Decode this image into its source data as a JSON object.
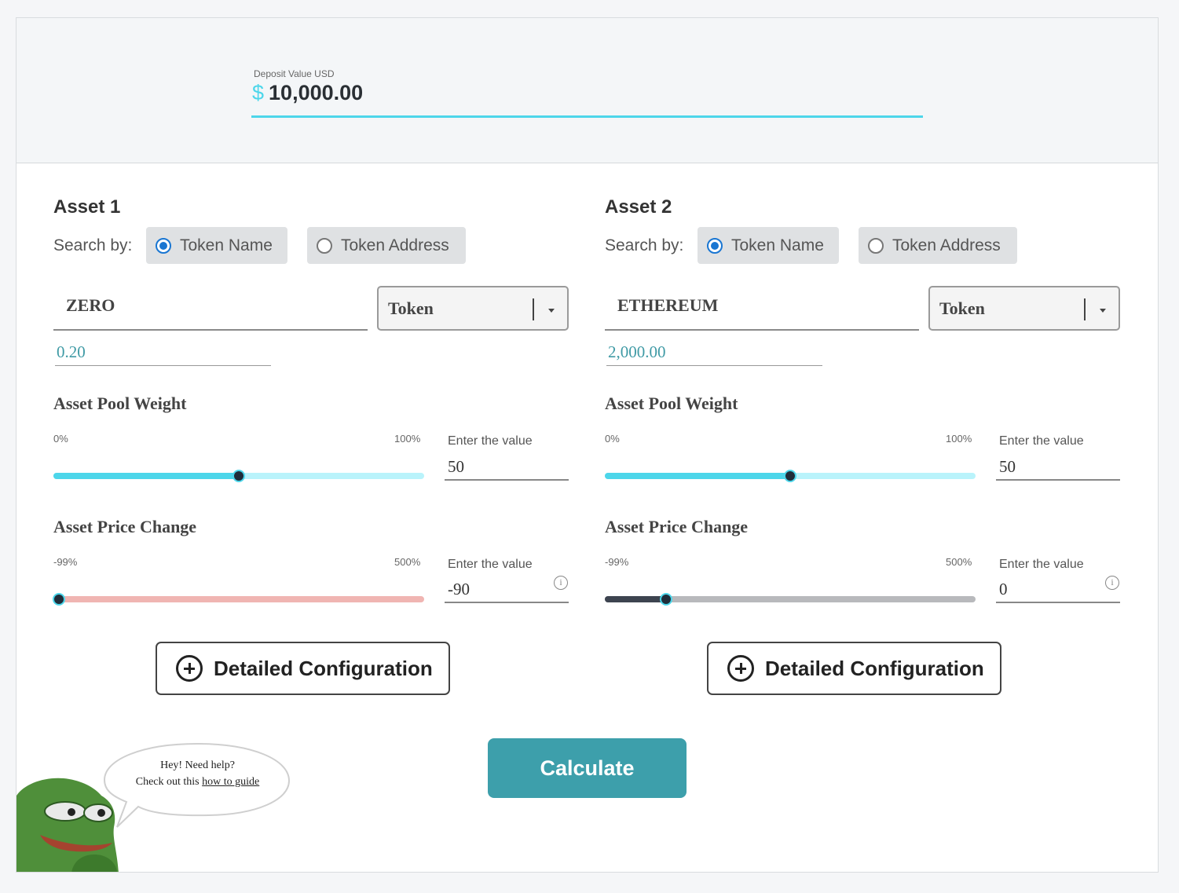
{
  "deposit": {
    "label": "Deposit Value USD",
    "currency": "$",
    "value": "10,000.00"
  },
  "assets": [
    {
      "title": "Asset 1",
      "search_by_label": "Search by:",
      "search_options": [
        "Token Name",
        "Token Address"
      ],
      "selected_option": "Token Name",
      "token_name": "ZERO",
      "token_type": "Token",
      "price": "0.20",
      "pool_weight": {
        "label": "Asset Pool Weight",
        "min": "0%",
        "max": "100%",
        "enter_label": "Enter the value",
        "value": "50",
        "slider_fraction": 0.5
      },
      "price_change": {
        "label": "Asset Price Change",
        "min": "-99%",
        "max": "500%",
        "enter_label": "Enter the value",
        "value": "-90",
        "slider_fraction": 0.015,
        "track_color": "#f0b5b2",
        "fill_color": "#f0b5b2"
      },
      "detail_button": "Detailed Configuration"
    },
    {
      "title": "Asset 2",
      "search_by_label": "Search by:",
      "search_options": [
        "Token Name",
        "Token Address"
      ],
      "selected_option": "Token Name",
      "token_name": "ETHEREUM",
      "token_type": "Token",
      "price": "2,000.00",
      "pool_weight": {
        "label": "Asset Pool Weight",
        "min": "0%",
        "max": "100%",
        "enter_label": "Enter the value",
        "value": "50",
        "slider_fraction": 0.5
      },
      "price_change": {
        "label": "Asset Price Change",
        "min": "-99%",
        "max": "500%",
        "enter_label": "Enter the value",
        "value": "0",
        "slider_fraction": 0.165,
        "track_color": "#b8b9bc",
        "fill_color": "#3d4450"
      },
      "detail_button": "Detailed Configuration"
    }
  ],
  "calculate_label": "Calculate",
  "help": {
    "line1": "Hey! Need help?",
    "line2_prefix": "Check out this",
    "link_text": "how to guide"
  },
  "colors": {
    "accent": "#4dd6ea",
    "accent_light": "#b9f3fb",
    "calculate_bg": "#3d9fab",
    "radio_selected": "#1976d2"
  },
  "icons": {
    "info": "info-icon",
    "plus": "plus-circle-icon",
    "caret": "chevron-down-icon",
    "mascot": "frog-mascot"
  }
}
